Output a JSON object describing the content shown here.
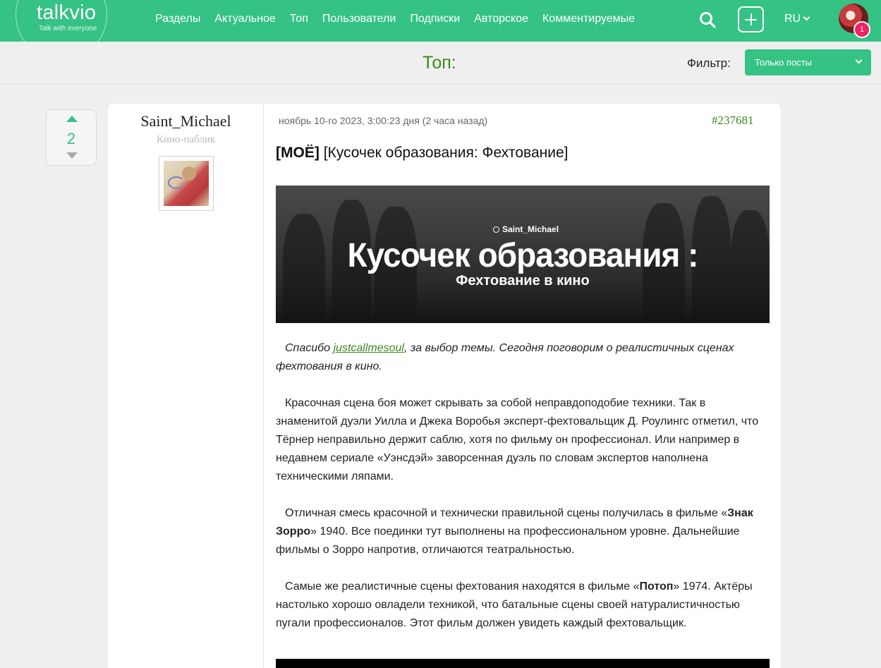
{
  "header": {
    "logo_name": "talkvio",
    "logo_tagline": "Talk with everyone",
    "nav": [
      "Разделы",
      "Актуальное",
      "Топ",
      "Пользователи",
      "Подписки",
      "Авторское",
      "Комментируемые"
    ],
    "lang": "RU",
    "notifications_count": "1",
    "accent_color": "#35c285",
    "badge_color": "#ef2361"
  },
  "subheader": {
    "title": "Топ:",
    "filter_label": "Фильтр:",
    "filter_value": "Только посты"
  },
  "post": {
    "votes": "2",
    "author": {
      "name": "Saint_Michael",
      "role": "Кино-паблик"
    },
    "date": "ноябрь 10-го 2023, 3:00:23 дня (2 часа назад)",
    "id": "#237681",
    "title_tag": "[МОЁ]",
    "title": "[Кусочек образования: Фехтование]",
    "banner": {
      "credit": "Saint_Michael",
      "title": "Кусочек образования :",
      "subtitle": "Фехтование в кино"
    },
    "intro": {
      "before": "Спасибо ",
      "link": "justcallmesoul",
      "after": ", за выбор темы. Сегодня поговорим о реалистичных сценах фехтования в кино."
    },
    "p1": "Красочная сцена боя может скрывать за собой неправдоподобие техники. Так в знаменитой дуэли Уилла и Джека Воробья эксперт-фехтовальщик Д. Роулингс отметил, что Тёрнер неправильно держит саблю, хотя по фильму он профессионал. Или например в недавнем сериале «Уэнсдэй» заворсенная дуэль по словам экспертов наполнена техническими ляпами.",
    "p2": {
      "before": "Отличная смесь красочной и технически правильной сцены получилась в фильме «",
      "bold": "Знак Зорро",
      "after": "» 1940. Все поединки тут выполнены на профессиональном уровне. Дальнейшие фильмы о Зорро напротив, отличаются театральностью."
    },
    "p3": {
      "before": "Самые же реалистичные сцены фехтования находятся в фильме «",
      "bold": "Потоп",
      "after": "» 1974. Актёры настолько хорошо овладели техникой, что батальные сцены своей натуралистичностью пугали профессионалов. Этот фильм должен увидеть каждый фехтовальщик."
    }
  }
}
